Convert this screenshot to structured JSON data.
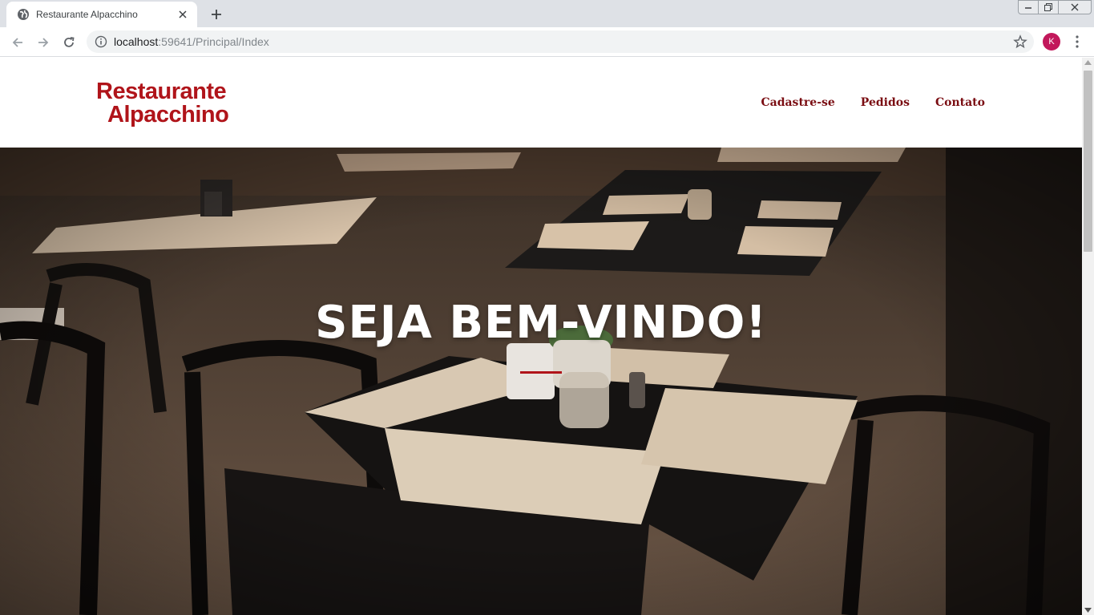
{
  "browser": {
    "tab_title": "Restaurante Alpacchino",
    "url_host": "localhost",
    "url_rest": ":59641/Principal/Index",
    "profile_initial": "K",
    "profile_color": "#c2185b"
  },
  "site": {
    "logo_line1": "Restaurante",
    "logo_line2": "Alpacchino",
    "brand_color": "#b0141a",
    "nav": [
      {
        "label": "Cadastre-se"
      },
      {
        "label": "Pedidos"
      },
      {
        "label": "Contato"
      }
    ]
  },
  "hero": {
    "title": "SEJA BEM-VINDO!",
    "image": "restaurant-tables-photo"
  }
}
